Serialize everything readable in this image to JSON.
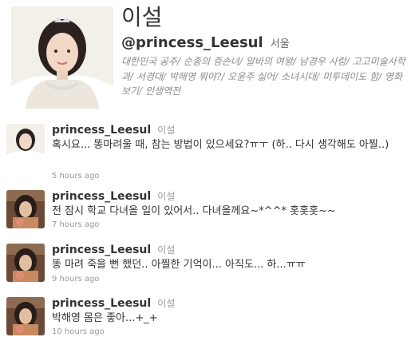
{
  "profile": {
    "name": "이설",
    "handle": "@princess_Leesul",
    "location": "서울",
    "bio": "대한민국 공주/ 순종의 증손녀/ 알바의 여왕/ 남경우 사랑/ 고고미술사학과/ 서경대/ 박해영 뭐야?/ 오윤주 싫어/ 소녀시대/ 미투데이도 함/ 영화보기/ 인생역전"
  },
  "tweets": [
    {
      "user": "princess_Leesul",
      "fullname": "이설",
      "text": "혹시요... 똥마려울 때, 참는 방법이 있으세요?ㅠㅜ (하.. 다시 생각해도 아찔..)",
      "time": "5 hours ago"
    },
    {
      "user": "princess_Leesul",
      "fullname": "이설",
      "text": "전 잠시 학교 다녀올 일이 있어서.. 다녀올께요~*^^* 홋홋홋~~",
      "time": "7 hours ago"
    },
    {
      "user": "princess_Leesul",
      "fullname": "이설",
      "text": "똥 마려 죽을 뻔 했던.. 아찔한 기억이... 아직도... 하...ㅠㅠ",
      "time": "9 hours ago"
    },
    {
      "user": "princess_Leesul",
      "fullname": "이설",
      "text": "박해영 몸은 좋아...+_+",
      "time": "10 hours ago"
    }
  ]
}
